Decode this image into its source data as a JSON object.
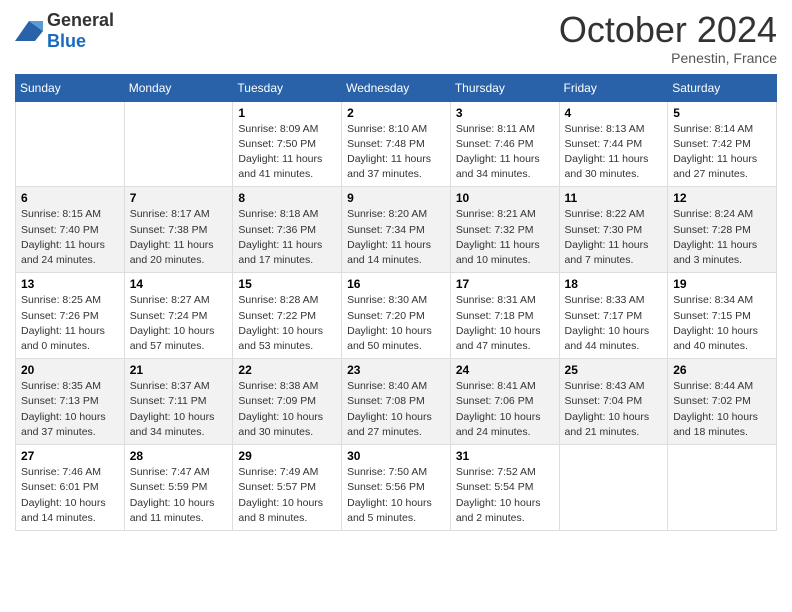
{
  "header": {
    "logo": {
      "general": "General",
      "blue": "Blue"
    },
    "title": "October 2024",
    "location": "Penestin, France"
  },
  "days_of_week": [
    "Sunday",
    "Monday",
    "Tuesday",
    "Wednesday",
    "Thursday",
    "Friday",
    "Saturday"
  ],
  "weeks": [
    [
      {
        "day": "",
        "info": ""
      },
      {
        "day": "",
        "info": ""
      },
      {
        "day": "1",
        "sunrise": "Sunrise: 8:09 AM",
        "sunset": "Sunset: 7:50 PM",
        "daylight": "Daylight: 11 hours and 41 minutes."
      },
      {
        "day": "2",
        "sunrise": "Sunrise: 8:10 AM",
        "sunset": "Sunset: 7:48 PM",
        "daylight": "Daylight: 11 hours and 37 minutes."
      },
      {
        "day": "3",
        "sunrise": "Sunrise: 8:11 AM",
        "sunset": "Sunset: 7:46 PM",
        "daylight": "Daylight: 11 hours and 34 minutes."
      },
      {
        "day": "4",
        "sunrise": "Sunrise: 8:13 AM",
        "sunset": "Sunset: 7:44 PM",
        "daylight": "Daylight: 11 hours and 30 minutes."
      },
      {
        "day": "5",
        "sunrise": "Sunrise: 8:14 AM",
        "sunset": "Sunset: 7:42 PM",
        "daylight": "Daylight: 11 hours and 27 minutes."
      }
    ],
    [
      {
        "day": "6",
        "sunrise": "Sunrise: 8:15 AM",
        "sunset": "Sunset: 7:40 PM",
        "daylight": "Daylight: 11 hours and 24 minutes."
      },
      {
        "day": "7",
        "sunrise": "Sunrise: 8:17 AM",
        "sunset": "Sunset: 7:38 PM",
        "daylight": "Daylight: 11 hours and 20 minutes."
      },
      {
        "day": "8",
        "sunrise": "Sunrise: 8:18 AM",
        "sunset": "Sunset: 7:36 PM",
        "daylight": "Daylight: 11 hours and 17 minutes."
      },
      {
        "day": "9",
        "sunrise": "Sunrise: 8:20 AM",
        "sunset": "Sunset: 7:34 PM",
        "daylight": "Daylight: 11 hours and 14 minutes."
      },
      {
        "day": "10",
        "sunrise": "Sunrise: 8:21 AM",
        "sunset": "Sunset: 7:32 PM",
        "daylight": "Daylight: 11 hours and 10 minutes."
      },
      {
        "day": "11",
        "sunrise": "Sunrise: 8:22 AM",
        "sunset": "Sunset: 7:30 PM",
        "daylight": "Daylight: 11 hours and 7 minutes."
      },
      {
        "day": "12",
        "sunrise": "Sunrise: 8:24 AM",
        "sunset": "Sunset: 7:28 PM",
        "daylight": "Daylight: 11 hours and 3 minutes."
      }
    ],
    [
      {
        "day": "13",
        "sunrise": "Sunrise: 8:25 AM",
        "sunset": "Sunset: 7:26 PM",
        "daylight": "Daylight: 11 hours and 0 minutes."
      },
      {
        "day": "14",
        "sunrise": "Sunrise: 8:27 AM",
        "sunset": "Sunset: 7:24 PM",
        "daylight": "Daylight: 10 hours and 57 minutes."
      },
      {
        "day": "15",
        "sunrise": "Sunrise: 8:28 AM",
        "sunset": "Sunset: 7:22 PM",
        "daylight": "Daylight: 10 hours and 53 minutes."
      },
      {
        "day": "16",
        "sunrise": "Sunrise: 8:30 AM",
        "sunset": "Sunset: 7:20 PM",
        "daylight": "Daylight: 10 hours and 50 minutes."
      },
      {
        "day": "17",
        "sunrise": "Sunrise: 8:31 AM",
        "sunset": "Sunset: 7:18 PM",
        "daylight": "Daylight: 10 hours and 47 minutes."
      },
      {
        "day": "18",
        "sunrise": "Sunrise: 8:33 AM",
        "sunset": "Sunset: 7:17 PM",
        "daylight": "Daylight: 10 hours and 44 minutes."
      },
      {
        "day": "19",
        "sunrise": "Sunrise: 8:34 AM",
        "sunset": "Sunset: 7:15 PM",
        "daylight": "Daylight: 10 hours and 40 minutes."
      }
    ],
    [
      {
        "day": "20",
        "sunrise": "Sunrise: 8:35 AM",
        "sunset": "Sunset: 7:13 PM",
        "daylight": "Daylight: 10 hours and 37 minutes."
      },
      {
        "day": "21",
        "sunrise": "Sunrise: 8:37 AM",
        "sunset": "Sunset: 7:11 PM",
        "daylight": "Daylight: 10 hours and 34 minutes."
      },
      {
        "day": "22",
        "sunrise": "Sunrise: 8:38 AM",
        "sunset": "Sunset: 7:09 PM",
        "daylight": "Daylight: 10 hours and 30 minutes."
      },
      {
        "day": "23",
        "sunrise": "Sunrise: 8:40 AM",
        "sunset": "Sunset: 7:08 PM",
        "daylight": "Daylight: 10 hours and 27 minutes."
      },
      {
        "day": "24",
        "sunrise": "Sunrise: 8:41 AM",
        "sunset": "Sunset: 7:06 PM",
        "daylight": "Daylight: 10 hours and 24 minutes."
      },
      {
        "day": "25",
        "sunrise": "Sunrise: 8:43 AM",
        "sunset": "Sunset: 7:04 PM",
        "daylight": "Daylight: 10 hours and 21 minutes."
      },
      {
        "day": "26",
        "sunrise": "Sunrise: 8:44 AM",
        "sunset": "Sunset: 7:02 PM",
        "daylight": "Daylight: 10 hours and 18 minutes."
      }
    ],
    [
      {
        "day": "27",
        "sunrise": "Sunrise: 7:46 AM",
        "sunset": "Sunset: 6:01 PM",
        "daylight": "Daylight: 10 hours and 14 minutes."
      },
      {
        "day": "28",
        "sunrise": "Sunrise: 7:47 AM",
        "sunset": "Sunset: 5:59 PM",
        "daylight": "Daylight: 10 hours and 11 minutes."
      },
      {
        "day": "29",
        "sunrise": "Sunrise: 7:49 AM",
        "sunset": "Sunset: 5:57 PM",
        "daylight": "Daylight: 10 hours and 8 minutes."
      },
      {
        "day": "30",
        "sunrise": "Sunrise: 7:50 AM",
        "sunset": "Sunset: 5:56 PM",
        "daylight": "Daylight: 10 hours and 5 minutes."
      },
      {
        "day": "31",
        "sunrise": "Sunrise: 7:52 AM",
        "sunset": "Sunset: 5:54 PM",
        "daylight": "Daylight: 10 hours and 2 minutes."
      },
      {
        "day": "",
        "info": ""
      },
      {
        "day": "",
        "info": ""
      }
    ]
  ]
}
